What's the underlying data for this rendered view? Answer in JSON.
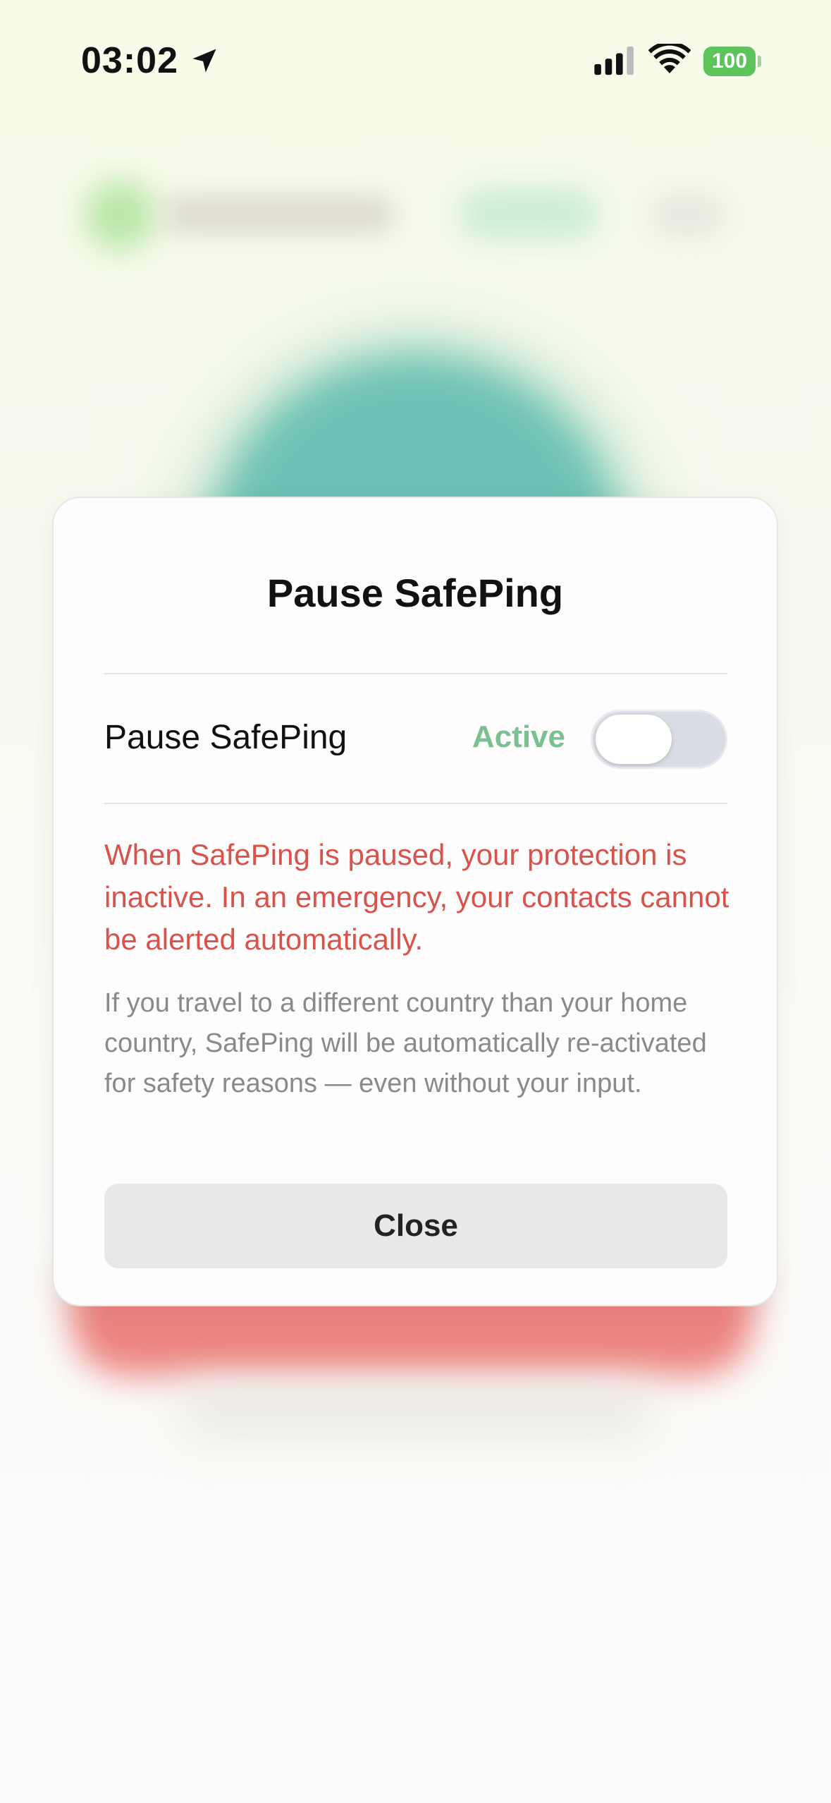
{
  "status_bar": {
    "time": "03:02",
    "battery": "100",
    "icons": [
      "location-arrow-icon",
      "cellular-signal-icon",
      "wifi-icon",
      "battery-icon"
    ]
  },
  "modal": {
    "title": "Pause SafePing",
    "toggle": {
      "label": "Pause SafePing",
      "status": "Active",
      "is_on": false
    },
    "warning": "When SafePing is paused, your protection is inactive. In an emergency, your contacts cannot be alerted automatically.",
    "info": "If you travel to a different country than your home country, SafePing will be automatically re-activated for safety reasons — even without your input.",
    "close_label": "Close"
  },
  "colors": {
    "status_active": "#7cbf90",
    "warning": "#d9534c",
    "info": "#8a8a8a",
    "battery": "#5cc45b",
    "toggle_off": "#d9dce3"
  }
}
